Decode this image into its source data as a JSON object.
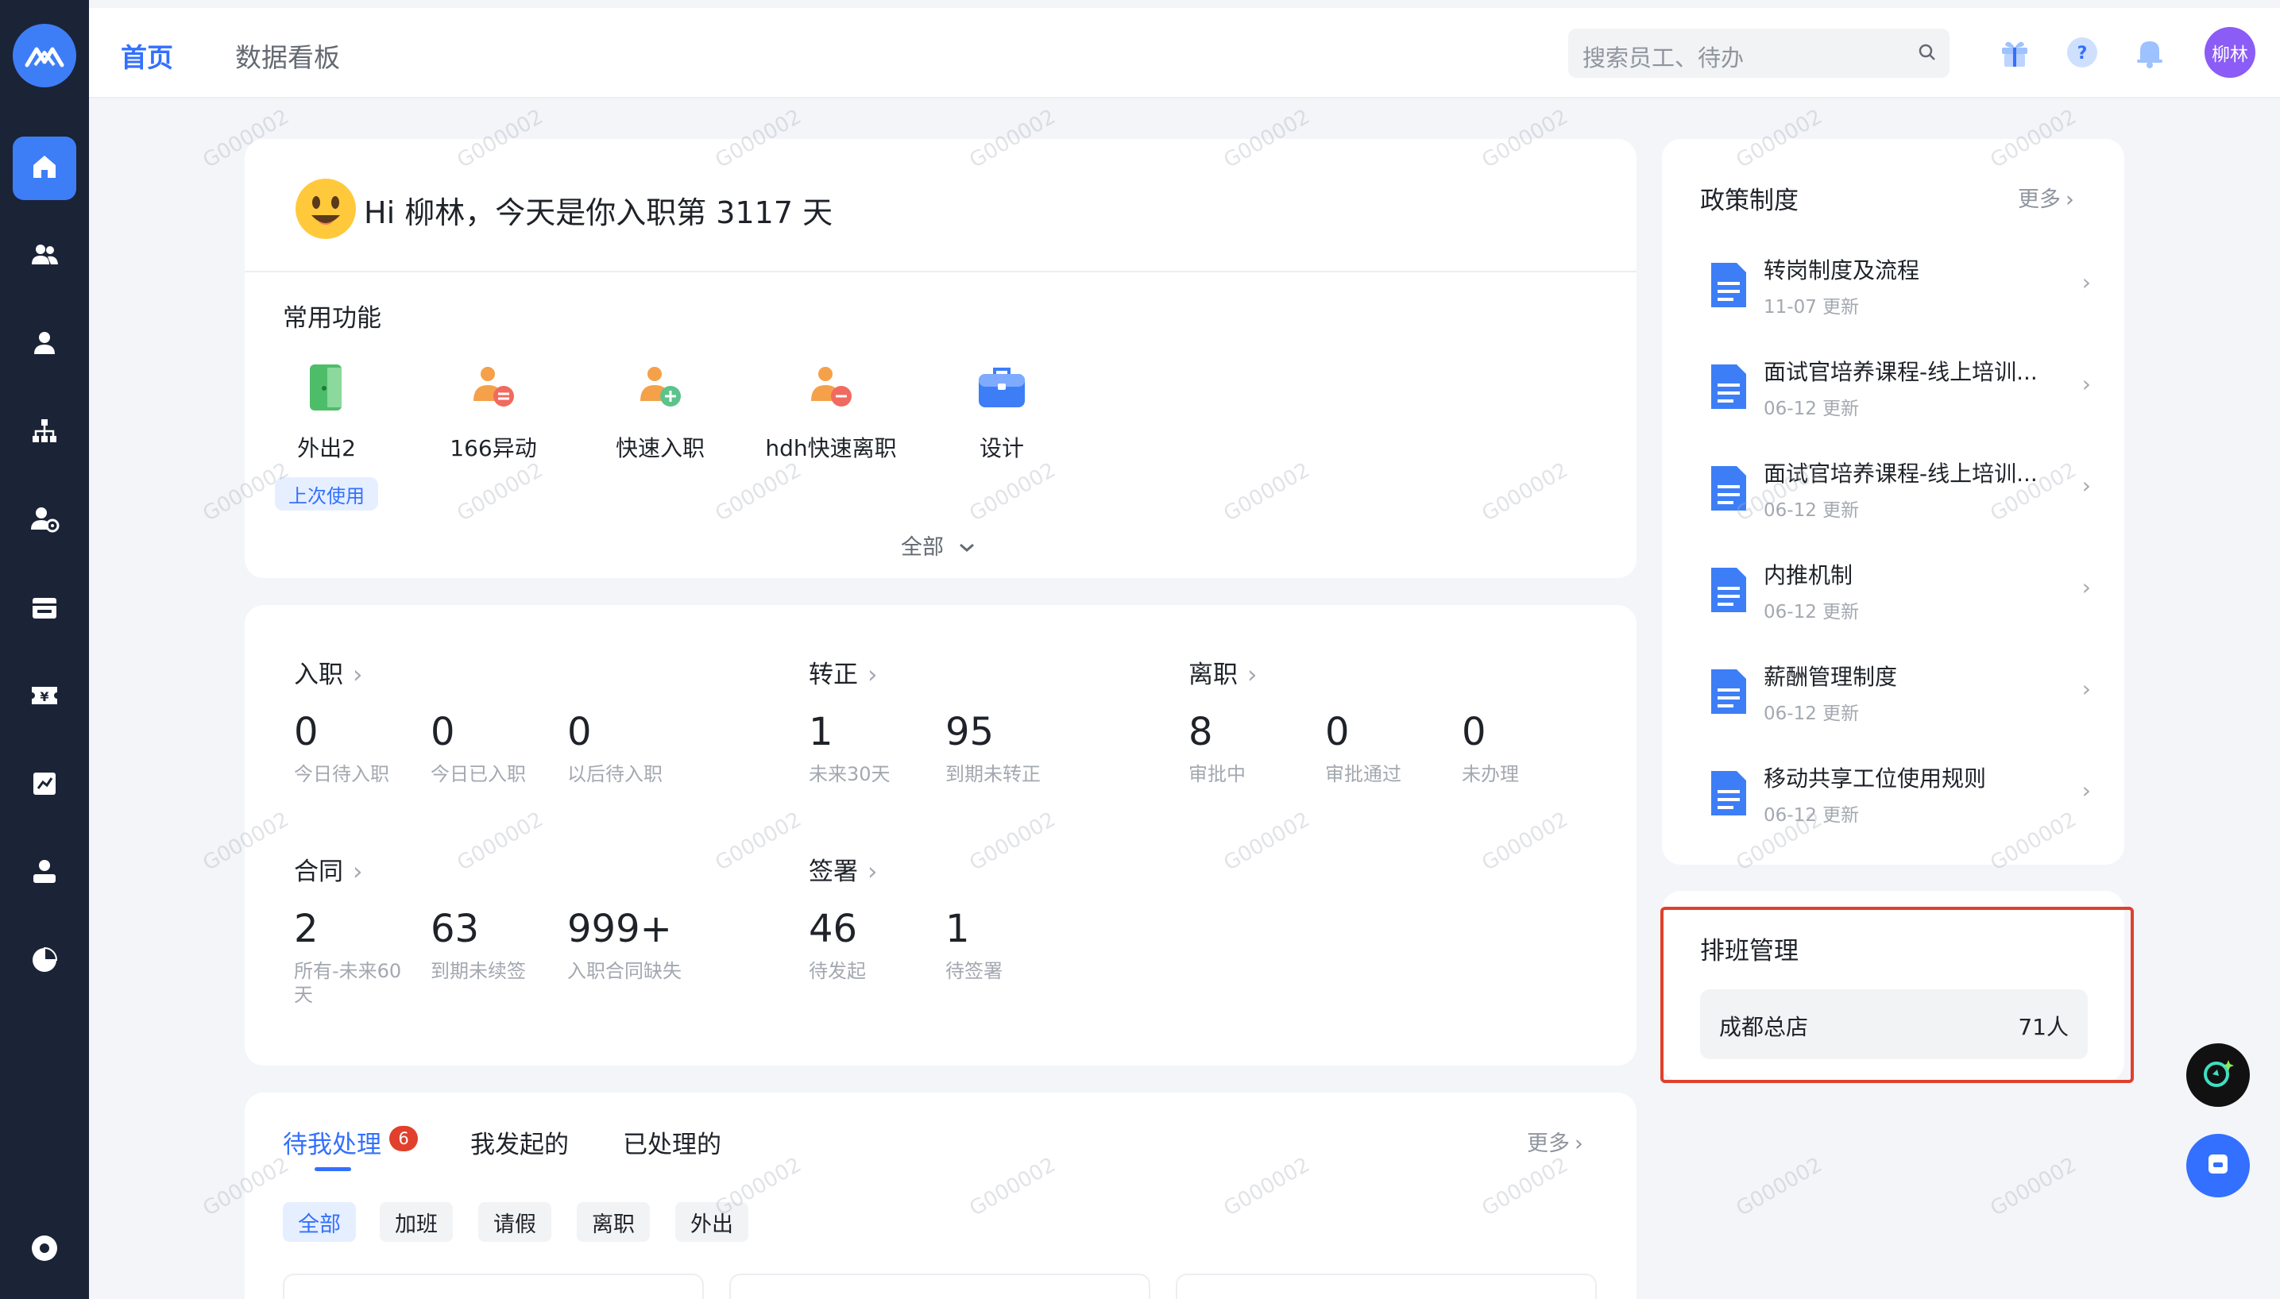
{
  "sidebar": {
    "logo": "logo-icon",
    "items": [
      {
        "icon": "home-icon",
        "active": true
      },
      {
        "icon": "people-icon"
      },
      {
        "icon": "person-icon"
      },
      {
        "icon": "org-chart-icon"
      },
      {
        "icon": "person-settings-icon"
      },
      {
        "icon": "calendar-icon"
      },
      {
        "icon": "salary-icon"
      },
      {
        "icon": "report-icon"
      },
      {
        "icon": "profile-icon"
      },
      {
        "icon": "pie-chart-icon"
      }
    ],
    "bottom_icon": "settings-icon"
  },
  "header": {
    "tabs": [
      "首页",
      "数据看板"
    ],
    "search_placeholder": "搜索员工、待办",
    "avatar": "柳林",
    "help": "?"
  },
  "welcome": {
    "greeting": "Hi 柳林，今天是你入职第 3117 天",
    "section_title": "常用功能",
    "functions": [
      {
        "label": "外出2",
        "icon": "door-icon"
      },
      {
        "label": "166异动",
        "icon": "person-transfer-icon"
      },
      {
        "label": "快速入职",
        "icon": "person-add-icon"
      },
      {
        "label": "hdh快速离职",
        "icon": "person-remove-icon"
      },
      {
        "label": "设计",
        "icon": "briefcase-icon"
      }
    ],
    "last_used": "上次使用",
    "all_label": "全部"
  },
  "stats": {
    "onboard": {
      "title": "入职",
      "items": [
        {
          "value": "0",
          "label": "今日待入职"
        },
        {
          "value": "0",
          "label": "今日已入职"
        },
        {
          "value": "0",
          "label": "以后待入职"
        }
      ]
    },
    "regular": {
      "title": "转正",
      "items": [
        {
          "value": "1",
          "label": "未来30天"
        },
        {
          "value": "95",
          "label": "到期未转正"
        }
      ]
    },
    "resign": {
      "title": "离职",
      "items": [
        {
          "value": "8",
          "label": "审批中"
        },
        {
          "value": "0",
          "label": "审批通过"
        },
        {
          "value": "0",
          "label": "未办理"
        }
      ]
    },
    "contract": {
      "title": "合同",
      "items": [
        {
          "value": "2",
          "label": "所有-未来60天"
        },
        {
          "value": "63",
          "label": "到期未续签"
        },
        {
          "value": "999+",
          "label": "入职合同缺失"
        }
      ]
    },
    "sign": {
      "title": "签署",
      "items": [
        {
          "value": "46",
          "label": "待发起"
        },
        {
          "value": "1",
          "label": "待签署"
        }
      ]
    }
  },
  "todo": {
    "tabs": [
      "待我处理",
      "我发起的",
      "已处理的"
    ],
    "badge": "6",
    "more": "更多",
    "filters": [
      "全部",
      "加班",
      "请假",
      "离职",
      "外出"
    ]
  },
  "policy": {
    "title": "政策制度",
    "more": "更多",
    "items": [
      {
        "title": "转岗制度及流程",
        "date": "11-07 更新"
      },
      {
        "title": "面试官培养课程-线上培训...",
        "date": "06-12 更新"
      },
      {
        "title": "面试官培养课程-线上培训...",
        "date": "06-12 更新"
      },
      {
        "title": "内推机制",
        "date": "06-12 更新"
      },
      {
        "title": "薪酬管理制度",
        "date": "06-12 更新"
      },
      {
        "title": "移动共享工位使用规则",
        "date": "06-12 更新"
      }
    ]
  },
  "schedule": {
    "title": "排班管理",
    "store": "成都总店",
    "count": "71人"
  },
  "watermark": "G000002",
  "colors": {
    "accent": "#3370ff",
    "sidebar": "#1b2337",
    "highlight_border": "#e0402c",
    "badge": "#e0402c"
  }
}
